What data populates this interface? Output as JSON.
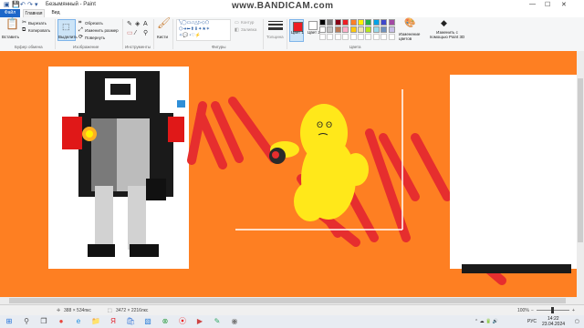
{
  "window": {
    "title": "Безымянный - Paint",
    "watermark": "www.BANDICAM.com",
    "quick_access": [
      "save-icon",
      "undo-icon",
      "redo-icon"
    ],
    "controls": [
      "minimize-icon",
      "maximize-icon",
      "close-icon"
    ]
  },
  "tabs": {
    "file": "Файл",
    "home": "Главная",
    "view": "Вид"
  },
  "ribbon": {
    "clipboard": {
      "paste": "Вставить",
      "cut": "Вырезать",
      "copy": "Копировать",
      "group": "Буфер обмена"
    },
    "image": {
      "select": "Выделить",
      "crop": "Обрезать",
      "resize": "Изменить размер",
      "rotate": "Повернуть",
      "group": "Изображение"
    },
    "tools": {
      "group": "Инструменты"
    },
    "brushes": {
      "label": "Кисти"
    },
    "shapes": {
      "outline": "Контур",
      "fill": "Заливка",
      "group": "Фигуры"
    },
    "size": {
      "label": "Толщина"
    },
    "colors": {
      "color1": "Цвет 1",
      "color2": "Цвет 2",
      "edit": "Изменение цветов",
      "paint3d": "Изменить с помощью Paint 3D",
      "group": "Цвета",
      "color1_value": "#ed1c24",
      "color2_value": "#ffffff",
      "palette": [
        "#000000",
        "#7f7f7f",
        "#880015",
        "#ed1c24",
        "#ff7f27",
        "#fff200",
        "#22b14c",
        "#00a2e8",
        "#3f48cc",
        "#a349a4",
        "#ffffff",
        "#c3c3c3",
        "#b97a57",
        "#ffaec9",
        "#ffc90e",
        "#efe4b0",
        "#b5e61d",
        "#99d9ea",
        "#7092be",
        "#c8bfe7"
      ]
    }
  },
  "canvas": {
    "background": "#fe7f22"
  },
  "status": {
    "cursor": "388 × 534пкс",
    "canvas_size": "3472 × 2216пкс",
    "zoom": "100%"
  },
  "taskbar": {
    "lang": "РУС",
    "time": "14:22",
    "date": "23.04.2024",
    "apps": [
      "start-icon",
      "search-icon",
      "task-view-icon",
      "chrome-icon",
      "edge-icon",
      "explorer-icon",
      "yandex-icon",
      "store-icon",
      "photos-icon",
      "xbox-icon",
      "record-icon",
      "media-icon",
      "paint-icon",
      "camera-icon"
    ]
  }
}
